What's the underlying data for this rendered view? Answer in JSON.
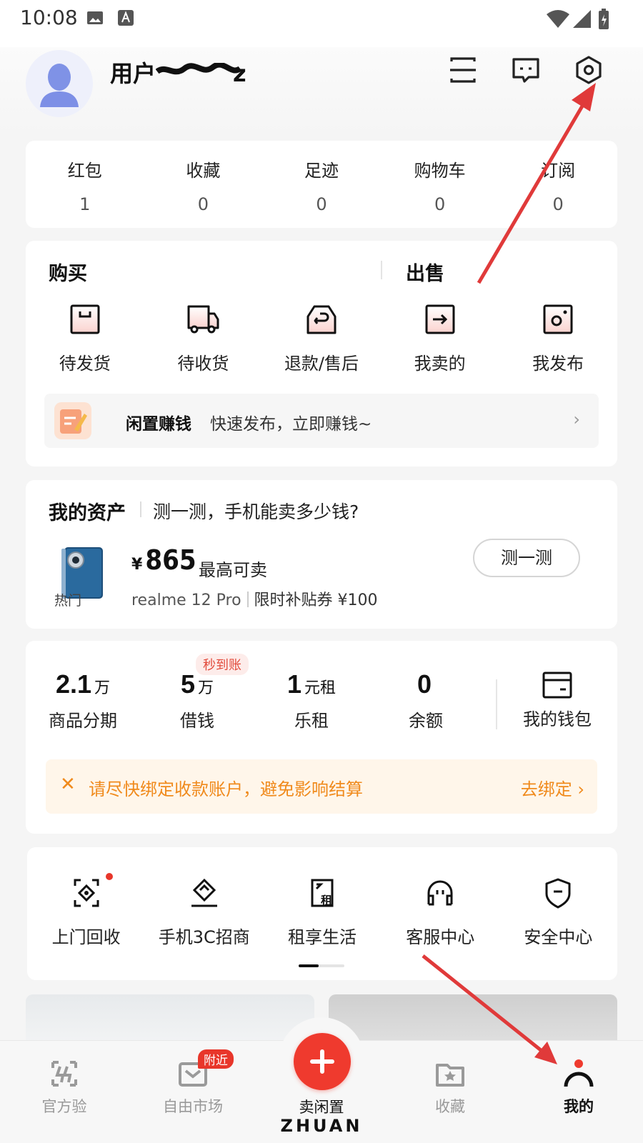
{
  "status_bar": {
    "time": "10:08"
  },
  "header": {
    "username": "用户",
    "username_redacted_tail": "z",
    "icons": [
      "scan-icon",
      "message-icon",
      "settings-icon"
    ]
  },
  "stats": [
    {
      "label": "红包",
      "value": "1"
    },
    {
      "label": "收藏",
      "value": "0"
    },
    {
      "label": "足迹",
      "value": "0"
    },
    {
      "label": "购物车",
      "value": "0"
    },
    {
      "label": "订阅",
      "value": "0"
    }
  ],
  "orders": {
    "buy_title": "购买",
    "sell_title": "出售",
    "items": [
      {
        "label": "待发货",
        "icon": "pending-ship-icon"
      },
      {
        "label": "待收货",
        "icon": "truck-icon"
      },
      {
        "label": "退款/售后",
        "icon": "refund-icon"
      },
      {
        "label": "我卖的",
        "icon": "sold-icon"
      },
      {
        "label": "我发布",
        "icon": "published-icon"
      }
    ],
    "earn": {
      "title": "闲置赚钱",
      "desc": "快速发布，立即赚钱~"
    }
  },
  "assets": {
    "title": "我的资产",
    "subtitle": "测一测，手机能卖多少钱?",
    "hot_tag": "热门",
    "currency": "¥",
    "price": "865",
    "max_sell": "最高可卖",
    "model": "realme 12 Pro",
    "coupon": "限时补贴券 ¥100",
    "test_button": "测一测"
  },
  "finance": {
    "items": [
      {
        "num": "2.1",
        "unit": "万",
        "label": "商品分期",
        "badge": ""
      },
      {
        "num": "5",
        "unit": "万",
        "label": "借钱",
        "badge": "秒到账"
      },
      {
        "num": "1",
        "unit": "元租",
        "label": "乐租",
        "badge": ""
      },
      {
        "num": "0",
        "unit": "",
        "label": "余额",
        "badge": ""
      }
    ],
    "wallet_label": "我的钱包",
    "bind_notice": "请尽快绑定收款账户，避免影响结算",
    "bind_action": "去绑定"
  },
  "services": [
    {
      "label": "上门回收",
      "icon": "recycle-icon",
      "dot": true
    },
    {
      "label": "手机3C招商",
      "icon": "merchant-icon",
      "dot": false
    },
    {
      "label": "租享生活",
      "icon": "rent-icon",
      "dot": false
    },
    {
      "label": "客服中心",
      "icon": "headset-icon",
      "dot": false
    },
    {
      "label": "安全中心",
      "icon": "shield-icon",
      "dot": false
    }
  ],
  "bottom_nav": {
    "items": [
      {
        "label": "官方验",
        "icon": "official-check-icon"
      },
      {
        "label": "自由市场",
        "icon": "market-icon",
        "badge": "附近"
      },
      {
        "label": "卖闲置",
        "icon": "plus-icon"
      },
      {
        "label": "收藏",
        "icon": "favorites-icon"
      },
      {
        "label": "我的",
        "icon": "profile-icon"
      }
    ],
    "brand": "ZHUAN",
    "active": "我的"
  },
  "colors": {
    "accent": "#ef3a2e",
    "warning": "#f08a1c",
    "annotation": "#e03a3a"
  }
}
